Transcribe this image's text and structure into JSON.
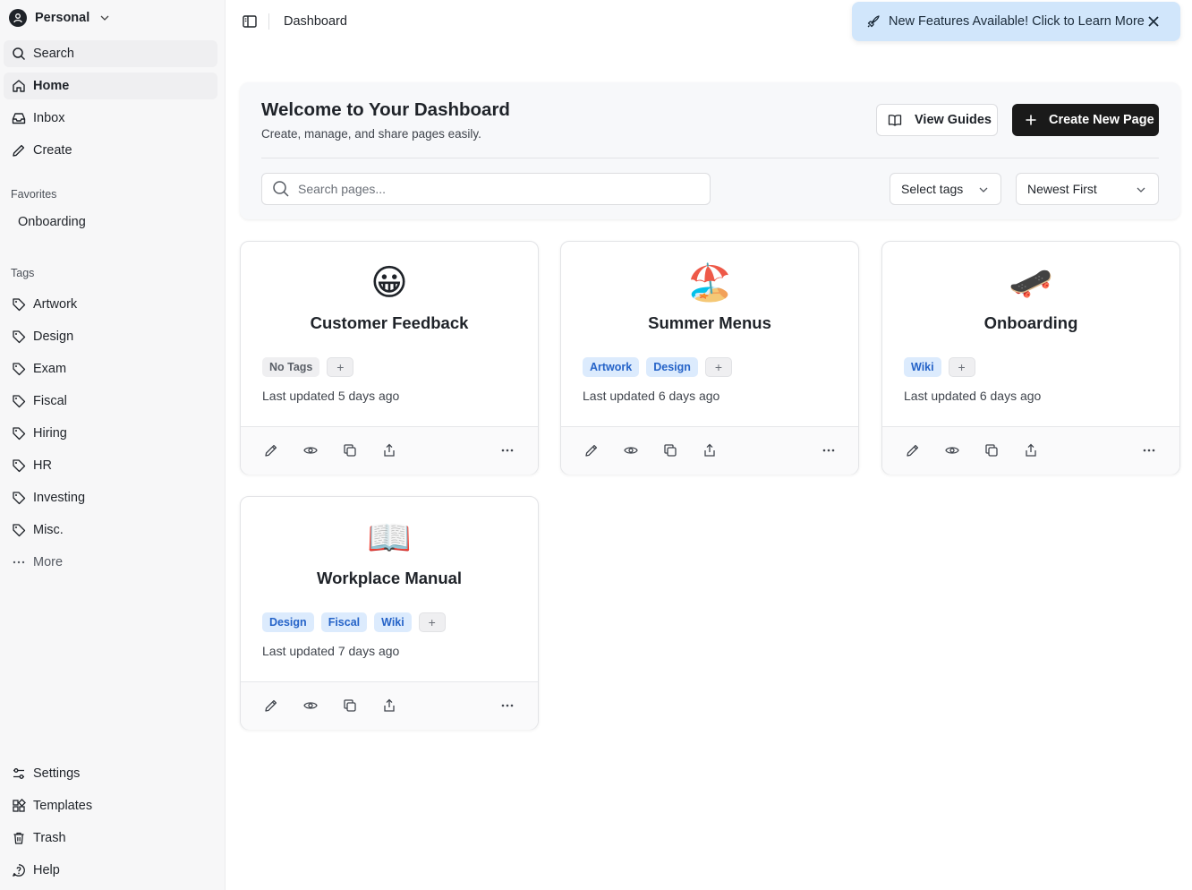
{
  "workspace": {
    "name": "Personal"
  },
  "sidebar": {
    "nav": [
      {
        "label": "Search",
        "icon": "search-icon"
      },
      {
        "label": "Home",
        "icon": "home-icon"
      },
      {
        "label": "Inbox",
        "icon": "inbox-icon"
      },
      {
        "label": "Create",
        "icon": "pencil-icon"
      }
    ],
    "favorites_label": "Favorites",
    "favorites": [
      "Onboarding"
    ],
    "tags_label": "Tags",
    "tags": [
      "Artwork",
      "Design",
      "Exam",
      "Fiscal",
      "Hiring",
      "HR",
      "Investing",
      "Misc."
    ],
    "more_label": "More",
    "bottom": [
      {
        "label": "Settings",
        "icon": "sliders-icon"
      },
      {
        "label": "Templates",
        "icon": "templates-icon"
      },
      {
        "label": "Trash",
        "icon": "trash-icon"
      },
      {
        "label": "Help",
        "icon": "help-icon"
      }
    ]
  },
  "topbar": {
    "breadcrumb": "Dashboard"
  },
  "toast": {
    "text": "New Features Available! Click to Learn More",
    "icon": "rocket-icon",
    "color": "#d1e6fb"
  },
  "hero": {
    "title": "Welcome to Your Dashboard",
    "subtitle": "Create, manage, and share pages easily.",
    "guides_label": "View Guides",
    "create_label": "Create New Page",
    "search_placeholder": "Search pages...",
    "tags_select": "Select tags",
    "sort_select": "Newest First"
  },
  "cards": [
    {
      "emoji": "😀",
      "title": "Customer Feedback",
      "tags": [],
      "no_tags_label": "No Tags",
      "updated": "Last updated 5 days ago"
    },
    {
      "emoji": "🏖️",
      "title": "Summer Menus",
      "tags": [
        "Artwork",
        "Design"
      ],
      "updated": "Last updated 6 days ago"
    },
    {
      "emoji": "🛹",
      "title": "Onboarding",
      "tags": [
        "Wiki"
      ],
      "updated": "Last updated 6 days ago"
    },
    {
      "emoji": "📖",
      "title": "Workplace Manual",
      "tags": [
        "Design",
        "Fiscal",
        "Wiki"
      ],
      "updated": "Last updated 7 days ago"
    }
  ],
  "colors": {
    "accent_dark": "#1a1a1a",
    "tag_bg": "#dcebfd",
    "tag_text": "#2563c8"
  }
}
